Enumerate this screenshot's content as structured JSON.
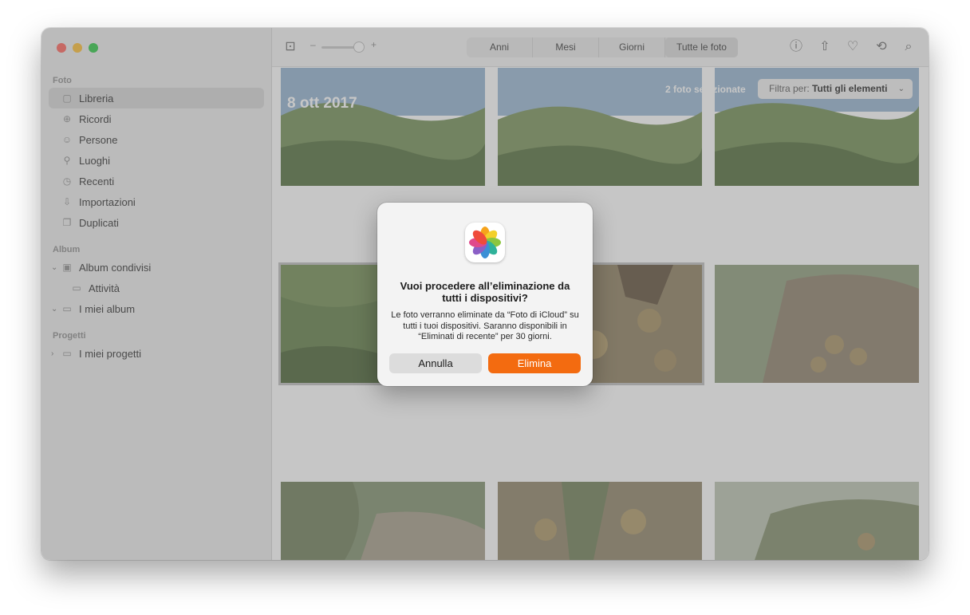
{
  "sidebar": {
    "sections": {
      "photos": "Foto",
      "album": "Album",
      "projects": "Progetti"
    },
    "items": [
      {
        "label": "Libreria",
        "icon": "library-icon"
      },
      {
        "label": "Ricordi",
        "icon": "memories-icon"
      },
      {
        "label": "Persone",
        "icon": "people-icon"
      },
      {
        "label": "Luoghi",
        "icon": "places-icon"
      },
      {
        "label": "Recenti",
        "icon": "recents-icon"
      },
      {
        "label": "Importazioni",
        "icon": "imports-icon"
      },
      {
        "label": "Duplicati",
        "icon": "duplicates-icon"
      }
    ],
    "album_items": [
      {
        "label": "Album condivisi",
        "icon": "shared-album-icon"
      },
      {
        "label": "Attività",
        "icon": "activity-icon"
      },
      {
        "label": "I miei album",
        "icon": "folder-icon"
      }
    ],
    "project_items": [
      {
        "label": "I miei progetti",
        "icon": "folder-icon"
      }
    ]
  },
  "toolbar": {
    "slider_minus": "–",
    "slider_plus": "+",
    "tabs": [
      "Anni",
      "Mesi",
      "Giorni",
      "Tutte le foto"
    ],
    "selected_tab": "Tutte le foto"
  },
  "grid": {
    "date": "8 ott 2017",
    "selection": "2 foto selezionate",
    "filter_prefix": "Filtra per:",
    "filter_value": "Tutti gli elementi"
  },
  "dialog": {
    "title": "Vuoi procedere all’eliminazione da tutti i dispositivi?",
    "message": "Le foto verranno eliminate da “Foto di iCloud” su tutti i tuoi dispositivi. Saranno disponibili in “Eliminati di recente” per 30 giorni.",
    "cancel_label": "Annulla",
    "delete_label": "Elimina"
  },
  "colors": {
    "accent": "#f36b10",
    "close": "#ff5f57",
    "minimize": "#febc2e",
    "maximize": "#28c840"
  }
}
